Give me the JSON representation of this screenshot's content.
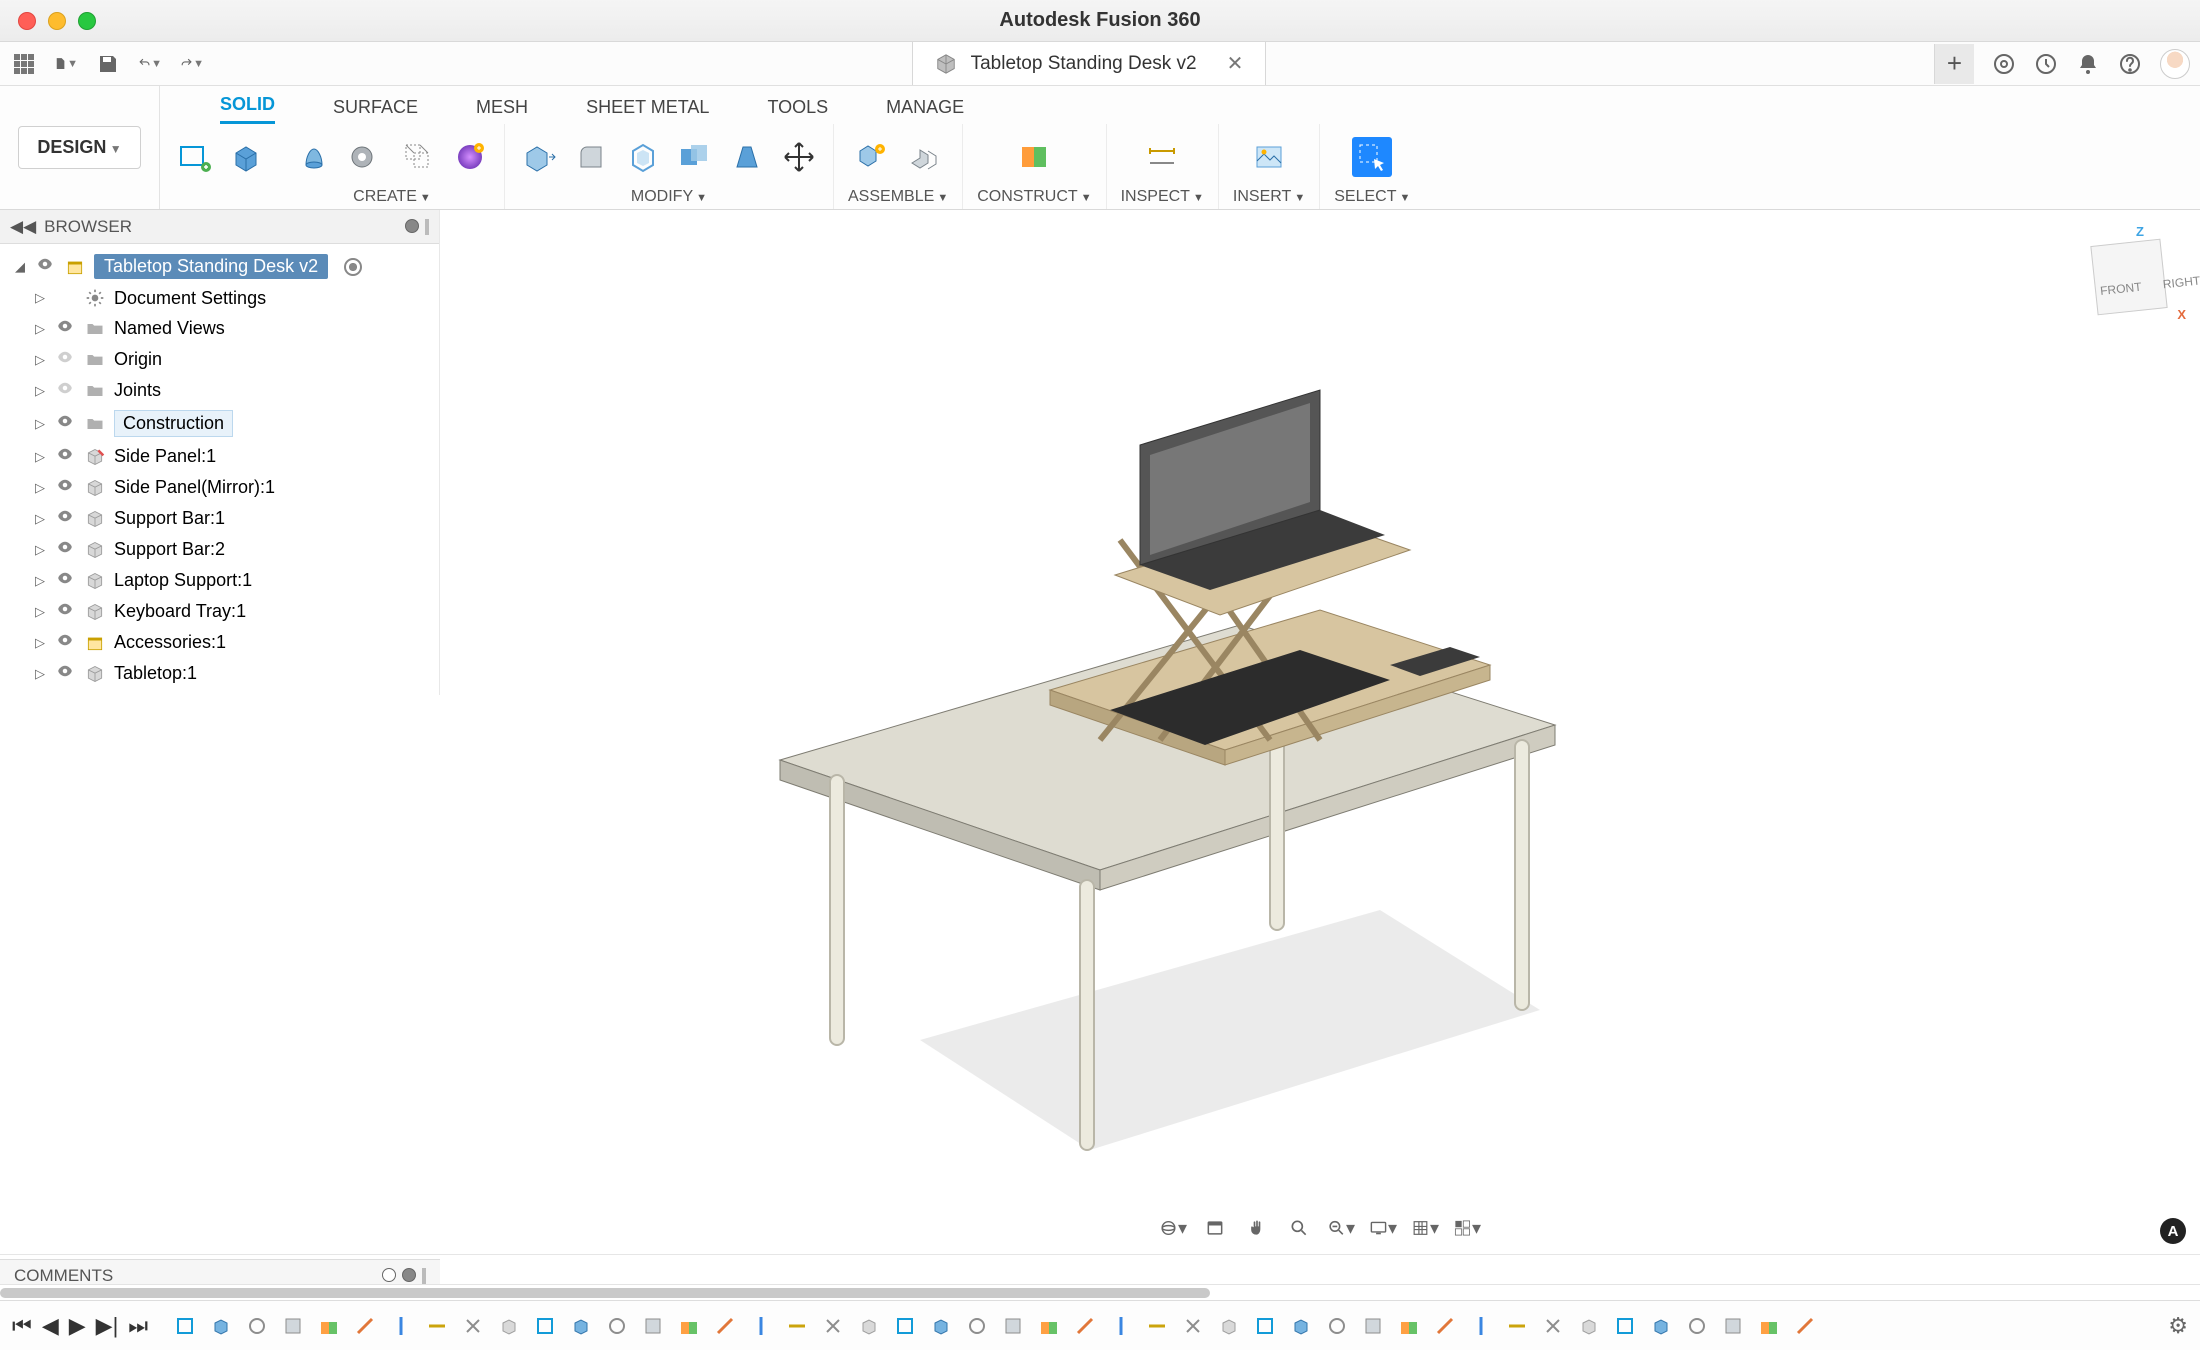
{
  "app": {
    "title": "Autodesk Fusion 360"
  },
  "document": {
    "name": "Tabletop Standing Desk v2"
  },
  "workspace": {
    "label": "DESIGN"
  },
  "ribbon_tabs": [
    "SOLID",
    "SURFACE",
    "MESH",
    "SHEET METAL",
    "TOOLS",
    "MANAGE"
  ],
  "ribbon_active_tab": "SOLID",
  "ribbon_groups": {
    "create": "CREATE",
    "modify": "MODIFY",
    "assemble": "ASSEMBLE",
    "construct": "CONSTRUCT",
    "inspect": "INSPECT",
    "insert": "INSERT",
    "select": "SELECT"
  },
  "browser": {
    "title": "BROWSER",
    "root": "Tabletop Standing Desk v2",
    "items": [
      {
        "label": "Document Settings",
        "icon": "gear"
      },
      {
        "label": "Named Views",
        "icon": "folder"
      },
      {
        "label": "Origin",
        "icon": "folder",
        "faded": true
      },
      {
        "label": "Joints",
        "icon": "folder",
        "faded": true
      },
      {
        "label": "Construction",
        "icon": "folder",
        "sel": true
      },
      {
        "label": "Side Panel:1",
        "icon": "component-red"
      },
      {
        "label": "Side Panel(Mirror):1",
        "icon": "component"
      },
      {
        "label": "Support Bar:1",
        "icon": "component"
      },
      {
        "label": "Support Bar:2",
        "icon": "component"
      },
      {
        "label": "Laptop Support:1",
        "icon": "component"
      },
      {
        "label": "Keyboard Tray:1",
        "icon": "component"
      },
      {
        "label": "Accessories:1",
        "icon": "assembly"
      },
      {
        "label": "Tabletop:1",
        "icon": "component"
      }
    ]
  },
  "comments": {
    "title": "COMMENTS"
  },
  "viewcube": {
    "front": "FRONT",
    "right": "RIGHT",
    "z": "Z",
    "x": "X"
  },
  "nav_icons": [
    "orbit",
    "calendar",
    "pan",
    "zoom-fit",
    "zoom",
    "display",
    "grid",
    "layout"
  ],
  "timeline_controls": [
    "first",
    "prev",
    "play",
    "next",
    "last"
  ],
  "timeline_item_count": 46,
  "qat_right_icons": [
    "extensions",
    "jobstatus",
    "notifications",
    "help"
  ],
  "brand_glyph": "A"
}
